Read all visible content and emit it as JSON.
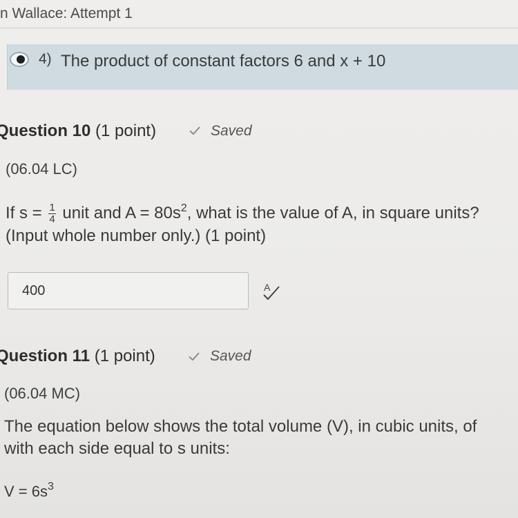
{
  "header": {
    "title": "n Wallace: Attempt 1"
  },
  "selected_answer": {
    "number": "4)",
    "text": "The product of constant factors 6 and x + 10"
  },
  "question10": {
    "title_bold": "Question 10",
    "points": "(1 point)",
    "status": "Saved",
    "code": "(06.04 LC)",
    "prompt_part1": "If s = ",
    "fraction_num": "1",
    "fraction_den": "4",
    "prompt_part2": " unit and A = 80s",
    "exponent": "2",
    "prompt_part3": ", what is the value of A, in square units?",
    "prompt_line2": "(Input whole number only.) (1 point)",
    "input_value": "400"
  },
  "question11": {
    "title_bold": "Question 11",
    "points": "(1 point)",
    "status": "Saved",
    "code": "(06.04 MC)",
    "line1": "The equation below shows the total volume (V), in cubic units, of",
    "line2": "with each side equal to s units:",
    "equation": "V = 6s",
    "equation_exponent": "3"
  },
  "colors": {
    "banner": "#cfdbe1",
    "background": "#efeeec",
    "text": "#3a3a3a"
  },
  "icons": {
    "check": "check-icon",
    "spellcheck": "spellcheck-icon",
    "radio": "radio-selected-icon"
  }
}
